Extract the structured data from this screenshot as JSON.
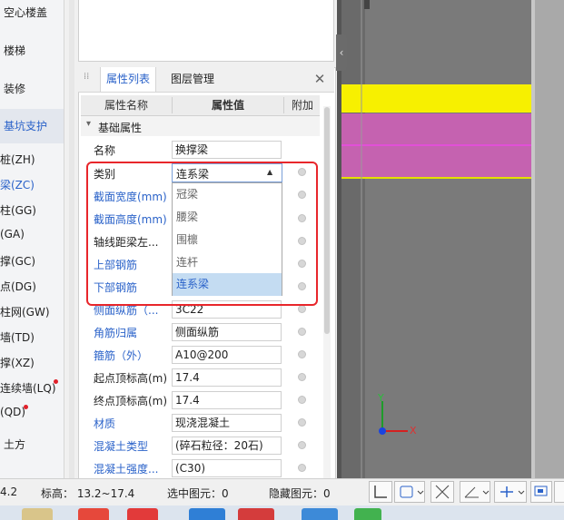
{
  "left_nav": {
    "major_items": [
      {
        "label": "空心楼盖"
      },
      {
        "label": "楼梯"
      },
      {
        "label": "装修"
      },
      {
        "label": "基坑支护"
      },
      {
        "label": "土方"
      }
    ],
    "sub_items": [
      {
        "label": "桩(ZH)"
      },
      {
        "label": "梁(ZC)"
      },
      {
        "label": "柱(GG)"
      },
      {
        "label": "(GA)"
      },
      {
        "label": "撑(GC)"
      },
      {
        "label": "点(DG)"
      },
      {
        "label": "柱网(GW)"
      },
      {
        "label": "墙(TD)"
      },
      {
        "label": "撑(XZ)"
      },
      {
        "label": "连续墙(LQ)"
      },
      {
        "label": "(QD)"
      }
    ]
  },
  "panel": {
    "tabs": [
      {
        "label": "属性列表"
      },
      {
        "label": "图层管理"
      }
    ],
    "close_symbol": "✕",
    "headers": {
      "name": "属性名称",
      "value": "属性值",
      "extra": "附加"
    },
    "section": {
      "toggle": "▾",
      "label": "基础属性"
    },
    "rows": [
      {
        "label": "名称",
        "value": "换撑梁"
      },
      {
        "label": "类别",
        "value": "连系梁"
      },
      {
        "label": "截面宽度(mm)",
        "value": ""
      },
      {
        "label": "截面高度(mm)",
        "value": ""
      },
      {
        "label": "轴线距梁左...",
        "value": ""
      },
      {
        "label": "上部钢筋",
        "value": ""
      },
      {
        "label": "下部钢筋",
        "value": ""
      },
      {
        "label": "侧面纵筋（...",
        "value": "3C22"
      },
      {
        "label": "角筋归属",
        "value": "侧面纵筋"
      },
      {
        "label": "箍筋（外）",
        "value": "A10@200"
      },
      {
        "label": "起点顶标高(m)",
        "value": "17.4"
      },
      {
        "label": "终点顶标高(m)",
        "value": "17.4"
      },
      {
        "label": "材质",
        "value": "现浇混凝土"
      },
      {
        "label": "混凝土类型",
        "value": "(碎石粒径：20石)"
      },
      {
        "label": "混凝土强度...",
        "value": "(C30)"
      }
    ],
    "dropdown": {
      "selected": "连系梁",
      "arrow": "▲",
      "options": [
        {
          "label": "冠梁"
        },
        {
          "label": "腰梁"
        },
        {
          "label": "围檩"
        },
        {
          "label": "连杆"
        },
        {
          "label": "连系梁"
        }
      ]
    }
  },
  "viewport": {
    "collapse_arrow": "‹",
    "axis_y": "Y",
    "axis_x": "X",
    "colors": {
      "background": "#3a3a3a",
      "yellow_band": "#f7f000",
      "magenta_band": "#c562b0",
      "column": "#a8a8a8"
    }
  },
  "statusbar": {
    "left_value": "4.2",
    "elevation": "标高： 13.2~17.4",
    "selected": "选中图元：0",
    "hidden": "隐藏图元：0"
  }
}
